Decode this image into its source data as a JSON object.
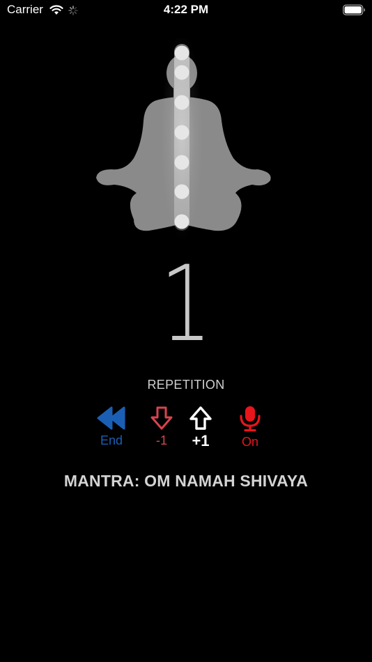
{
  "status_bar": {
    "carrier": "Carrier",
    "time": "4:22 PM",
    "icons": [
      "wifi-icon",
      "activity-spinner-icon",
      "battery-icon"
    ]
  },
  "figure": {
    "description_icon": "meditation-figure-icon",
    "chakra_count": 7
  },
  "counter": {
    "value": "1",
    "label": "REPETITION"
  },
  "controls": {
    "end": {
      "label": "End",
      "icon": "rewind-icon",
      "color": "#1a5fb4"
    },
    "minus": {
      "label": "-1",
      "icon": "arrow-down-icon",
      "color": "#d9434f"
    },
    "plus": {
      "label": "+1",
      "icon": "arrow-up-icon",
      "color": "#ffffff"
    },
    "mic": {
      "label": "On",
      "icon": "microphone-icon",
      "color": "#e8151b"
    }
  },
  "mantra": {
    "text": "MANTRA: OM NAMAH SHIVAYA"
  }
}
